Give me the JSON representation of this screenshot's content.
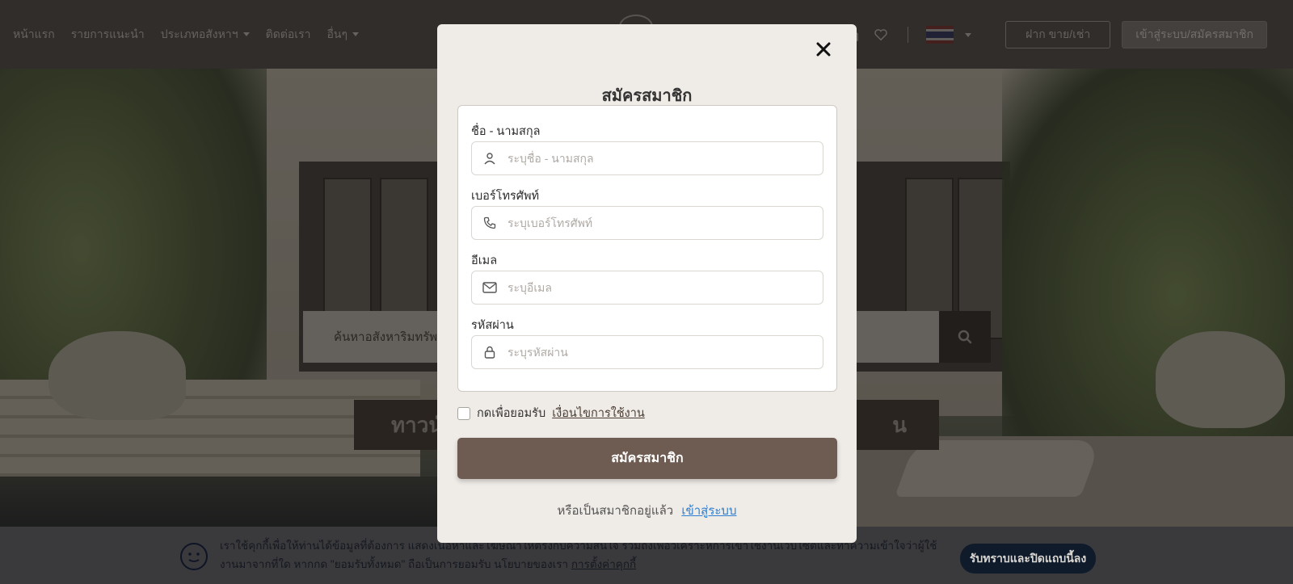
{
  "nav": {
    "items": [
      {
        "label": "หน้าแรก",
        "has_caret": false
      },
      {
        "label": "รายการแนะนำ",
        "has_caret": false
      },
      {
        "label": "ประเภทอสังหาฯ",
        "has_caret": true
      },
      {
        "label": "ติดต่อเรา",
        "has_caret": false
      },
      {
        "label": "อื่นๆ",
        "has_caret": true
      }
    ],
    "icons": [
      "home-icon",
      "heart-icon"
    ],
    "language_flag": "thai-flag-icon",
    "post_button": "ฝาก ขาย/เช่า",
    "login_button": "เข้าสู่ระบบ/สมัครสมาชิก"
  },
  "hero": {
    "search_placeholder": "ค้นหาอสังหาริมทรัพย์",
    "cta_left": "ทาวน์",
    "cta_right": "น"
  },
  "modal": {
    "title": "สมัครสมาชิก",
    "fields": {
      "name": {
        "label": "ชื่อ - นามสกุล",
        "placeholder": "ระบุชื่อ - นามสกุล",
        "value": "",
        "icon": "user-icon"
      },
      "phone": {
        "label": "เบอร์โทรศัพท์",
        "placeholder": "ระบุเบอร์โทรศัพท์",
        "value": "",
        "icon": "phone-icon"
      },
      "email": {
        "label": "อีเมล",
        "placeholder": "ระบุอีเมล",
        "value": "",
        "icon": "mail-icon"
      },
      "password": {
        "label": "รหัสผ่าน",
        "placeholder": "ระบุรหัสผ่าน",
        "value": "",
        "icon": "lock-icon"
      }
    },
    "agree_text": "กดเพื่อยอมรับ",
    "agree_link": "เงื่อนไขการใช้งาน",
    "agree_checked": false,
    "submit_label": "สมัครสมาชิก",
    "already_member_text": "หรือเป็นสมาชิกอยู่แล้ว",
    "login_link": "เข้าสู่ระบบ"
  },
  "cookie": {
    "text": "เราใช้คุกกี้เพื่อให้ท่านได้ข้อมูลที่ต้องการ แสดงเนื้อหาและโฆษณาให้ตรงกับความสนใจ รวมถึงเพื่อวิเคราะห์การเข้าใช้งานเว็บไซต์และทำความเข้าใจว่าผู้ใช้งานมาจากที่ใด หากกด \"ยอมรับทั้งหมด\" ถือเป็นการยอมรับ นโยบายของเรา",
    "link": "การตั้งค่าคุกกี้",
    "button": "รับทราบและปิดแถบนี้ลง"
  },
  "colors": {
    "primary_button": "#6e5c52",
    "link": "#2f7fd0",
    "modal_bg": "#efebe7",
    "cookie_button": "#0f1a2b"
  }
}
